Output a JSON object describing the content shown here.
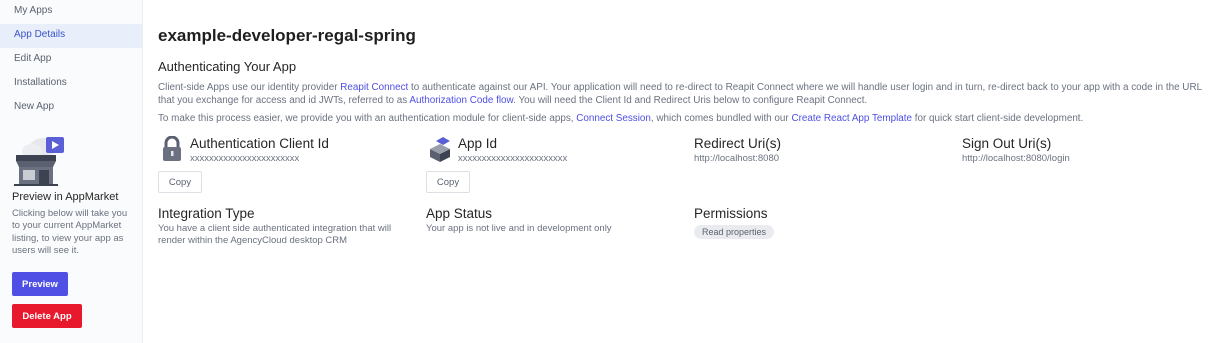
{
  "sidebar": {
    "items": [
      {
        "label": "My Apps"
      },
      {
        "label": "App Details"
      },
      {
        "label": "Edit App"
      },
      {
        "label": "Installations"
      },
      {
        "label": "New App"
      }
    ],
    "active_index": 1,
    "preview_title": "Preview in AppMarket",
    "preview_text": "Clicking below will take you to your current AppMarket listing, to view your app as users will see it.",
    "preview_button": "Preview",
    "delete_button": "Delete App"
  },
  "main": {
    "title": "example-developer-regal-spring",
    "section_title": "Authenticating Your App",
    "p1": {
      "t1": "Client-side Apps use our identity provider ",
      "l1": "Reapit Connect",
      "t2": " to authenticate against our API. Your application will need to re-direct to Reapit Connect where we will handle user login and in turn, re-direct back to your app with a code in the URL that you exchange for access and id JWTs, referred to as ",
      "l2": "Authorization Code flow",
      "t3": ". You will need the Client Id and Redirect Uris below to configure Reapit Connect."
    },
    "p2": {
      "t1": "To make this process easier, we provide you with an authentication module for client-side apps, ",
      "l1": "Connect Session",
      "t2": ", which comes bundled with our ",
      "l2": "Create React App Template",
      "t3": " for quick start client-side development."
    },
    "client_id": {
      "label": "Authentication Client Id",
      "value": "xxxxxxxxxxxxxxxxxxxxxxx",
      "copy": "Copy"
    },
    "app_id": {
      "label": "App Id",
      "value": "xxxxxxxxxxxxxxxxxxxxxxx",
      "copy": "Copy"
    },
    "redirect": {
      "label": "Redirect Uri(s)",
      "value": "http://localhost:8080"
    },
    "signout": {
      "label": "Sign Out Uri(s)",
      "value": "http://localhost:8080/login"
    },
    "integration": {
      "label": "Integration Type",
      "value": "You have a client side authenticated integration that will render within the AgencyCloud desktop CRM"
    },
    "status": {
      "label": "App Status",
      "value": "Your app is not live and in development only"
    },
    "permissions": {
      "label": "Permissions",
      "tags": [
        "Read properties"
      ]
    }
  },
  "colors": {
    "accent": "#4f4fe6",
    "danger": "#e8192c",
    "active_bg": "#e9eefb"
  },
  "icons": {
    "client_id": "lock-icon",
    "app_id": "cube-icon",
    "preview": "storefront-illustration"
  }
}
